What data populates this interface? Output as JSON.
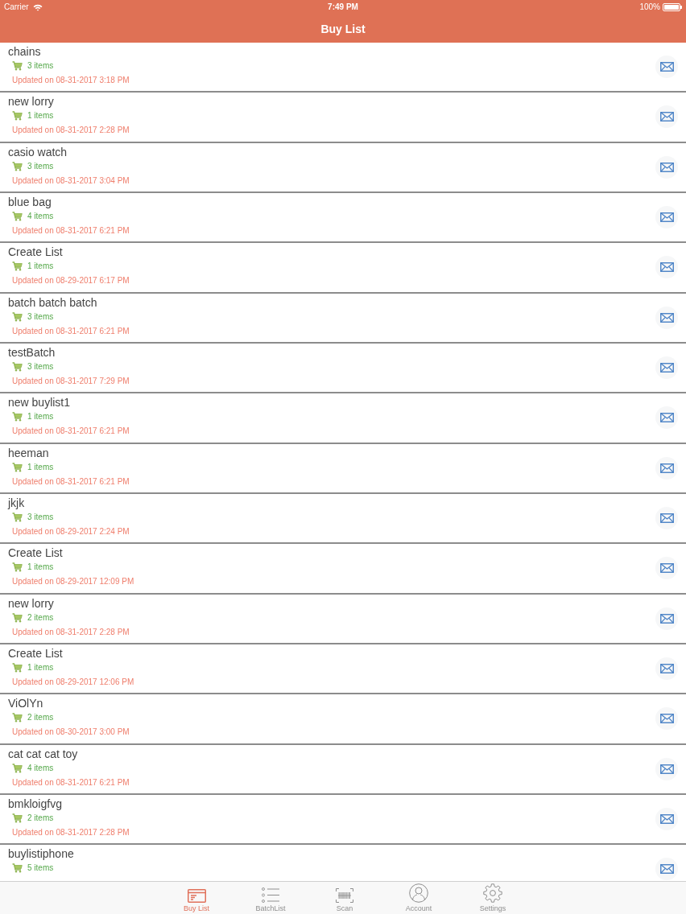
{
  "status_bar": {
    "carrier": "Carrier",
    "time": "7:49 PM",
    "battery": "100%"
  },
  "nav_bar": {
    "title": "Buy List"
  },
  "lists": [
    {
      "name": "chains",
      "items": "3 items",
      "updated": "Updated on 08-31-2017 3:18 PM"
    },
    {
      "name": "new lorry",
      "items": "1 items",
      "updated": "Updated on 08-31-2017 2:28 PM"
    },
    {
      "name": "casio watch",
      "items": "3 items",
      "updated": "Updated on 08-31-2017 3:04 PM"
    },
    {
      "name": "blue bag",
      "items": "4 items",
      "updated": "Updated on 08-31-2017 6:21 PM"
    },
    {
      "name": "Create List",
      "items": "1 items",
      "updated": "Updated on 08-29-2017 6:17 PM"
    },
    {
      "name": "batch batch batch",
      "items": "3 items",
      "updated": "Updated on 08-31-2017 6:21 PM"
    },
    {
      "name": "testBatch",
      "items": "3 items",
      "updated": "Updated on 08-31-2017 7:29 PM"
    },
    {
      "name": "new buylist1",
      "items": "1 items",
      "updated": "Updated on 08-31-2017 6:21 PM"
    },
    {
      "name": "heeman",
      "items": "1 items",
      "updated": "Updated on 08-31-2017 6:21 PM"
    },
    {
      "name": "jkjk",
      "items": "3 items",
      "updated": "Updated on 08-29-2017 2:24 PM"
    },
    {
      "name": "Create List",
      "items": "1 items",
      "updated": "Updated on 08-29-2017 12:09 PM"
    },
    {
      "name": "new lorry",
      "items": "2 items",
      "updated": "Updated on 08-31-2017 2:28 PM"
    },
    {
      "name": "Create List",
      "items": "1 items",
      "updated": "Updated on 08-29-2017 12:06 PM"
    },
    {
      "name": "ViOlYn",
      "items": "2 items",
      "updated": "Updated on 08-30-2017 3:00 PM"
    },
    {
      "name": "cat cat cat toy",
      "items": "4 items",
      "updated": "Updated on 08-31-2017 6:21 PM"
    },
    {
      "name": "bmkloigfvg",
      "items": "2 items",
      "updated": "Updated on 08-31-2017 2:28 PM"
    },
    {
      "name": "buylistiphone",
      "items": "5 items"
    }
  ],
  "tab_bar": [
    {
      "label": "Buy List",
      "selected": true,
      "kind": "card"
    },
    {
      "label": "BatchList",
      "selected": false,
      "kind": "list"
    },
    {
      "label": "Scan",
      "selected": false,
      "kind": "scan"
    },
    {
      "label": "Account",
      "selected": false,
      "kind": "account"
    },
    {
      "label": "Settings",
      "selected": false,
      "kind": "settings"
    }
  ]
}
